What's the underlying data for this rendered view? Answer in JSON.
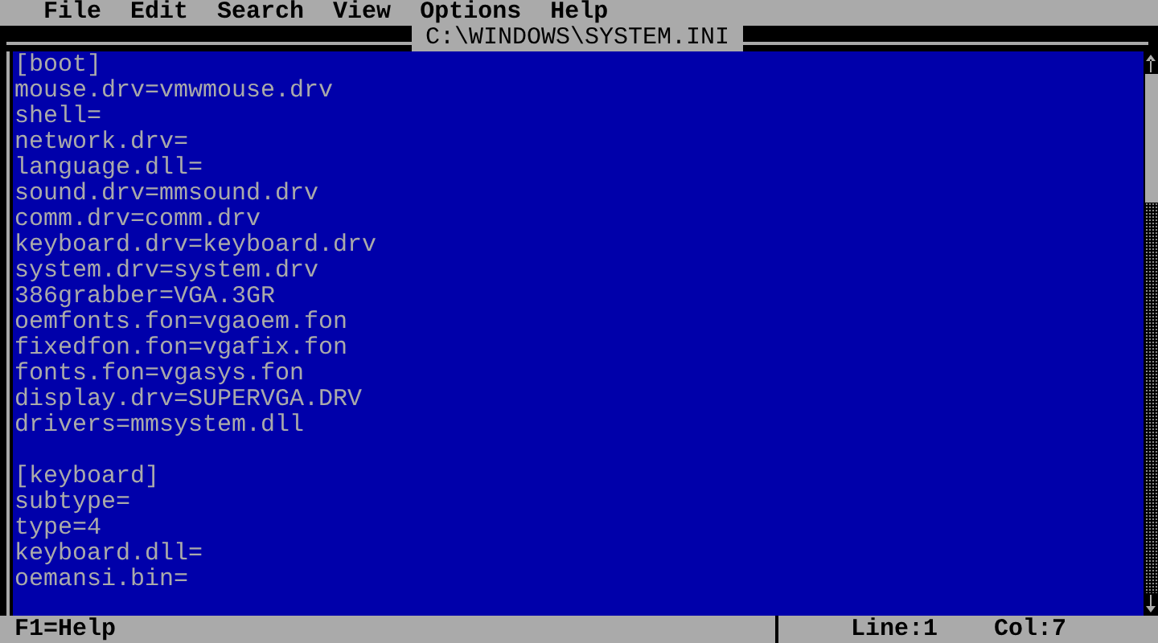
{
  "menu": [
    "File",
    "Edit",
    "Search",
    "View",
    "Options",
    "Help"
  ],
  "window": {
    "title": "C:\\WINDOWS\\SYSTEM.INI"
  },
  "sections": [
    {
      "header": "[boot]",
      "lines": [
        "mouse.drv=vmwmouse.drv",
        "shell=",
        "network.drv=",
        "language.dll=",
        "sound.drv=mmsound.drv",
        "comm.drv=comm.drv",
        "keyboard.drv=keyboard.drv",
        "system.drv=system.drv",
        "386grabber=VGA.3GR",
        "oemfonts.fon=vgaoem.fon",
        "fixedfon.fon=vgafix.fon",
        "fonts.fon=vgasys.fon",
        "display.drv=SUPERVGA.DRV",
        "drivers=mmsystem.dll"
      ]
    },
    {
      "header": "[keyboard]",
      "lines": [
        "subtype=",
        "type=4",
        "keyboard.dll=",
        "oemansi.bin="
      ]
    }
  ],
  "status_bar": {
    "help": "F1=Help",
    "line": "Line:1",
    "col": "Col:7"
  }
}
